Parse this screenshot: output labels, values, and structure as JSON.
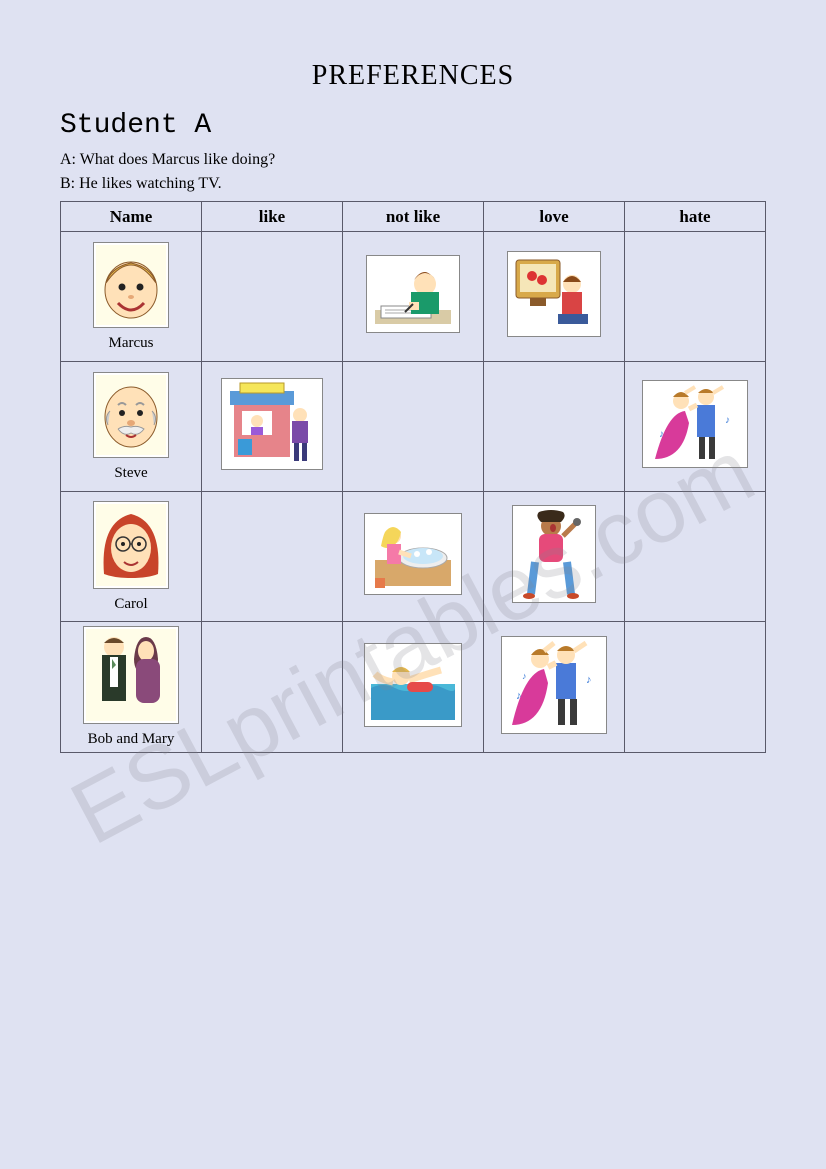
{
  "title": "PREFERENCES",
  "subtitle": "Student A",
  "dialogue": {
    "lineA": "A: What does Marcus like doing?",
    "lineB": "B: He likes watching TV."
  },
  "headers": {
    "name": "Name",
    "like": "like",
    "notLike": "not like",
    "love": "love",
    "hate": "hate"
  },
  "rows": [
    {
      "person": "Marcus",
      "personIcon": "boy-face",
      "like": null,
      "notLike": "writing",
      "love": "watching-tv",
      "hate": null
    },
    {
      "person": "Steve",
      "personIcon": "bald-man-face",
      "like": "shopping-booth",
      "notLike": null,
      "love": null,
      "hate": "dancing"
    },
    {
      "person": "Carol",
      "personIcon": "woman-glasses-face",
      "like": null,
      "notLike": "washing-dishes",
      "love": "singing",
      "hate": null
    },
    {
      "person": "Bob and Mary",
      "personIcon": "couple",
      "like": null,
      "notLike": "swimming",
      "love": "dancing",
      "hate": null
    }
  ],
  "watermark": "ESLprintables.com"
}
